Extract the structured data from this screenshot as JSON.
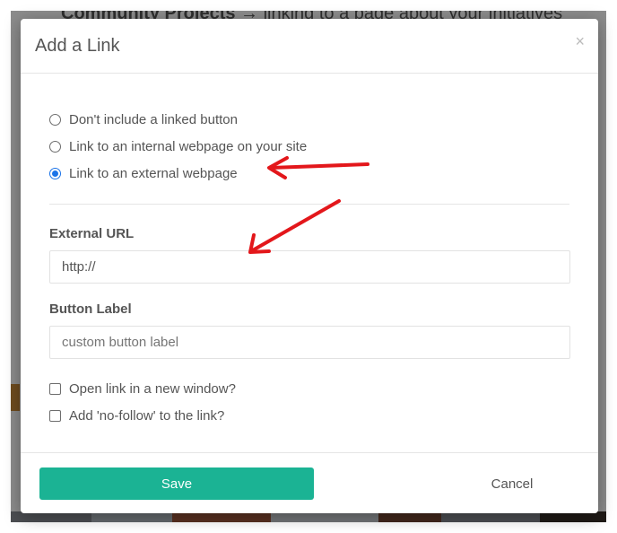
{
  "background": {
    "heading_bold": "Community Projects",
    "heading_rest": " → linking to a page about your initiatives"
  },
  "modal": {
    "title": "Add a Link",
    "close_glyph": "×",
    "options": [
      {
        "label": "Don't include a linked button",
        "checked": false
      },
      {
        "label": "Link to an internal webpage on your site",
        "checked": false
      },
      {
        "label": "Link to an external webpage",
        "checked": true
      }
    ],
    "external_url": {
      "label": "External URL",
      "value": "http://"
    },
    "button_label": {
      "label": "Button Label",
      "placeholder": "custom button label"
    },
    "new_window": {
      "label": "Open link in a new window?",
      "checked": false
    },
    "no_follow": {
      "label": "Add 'no-follow' to the link?",
      "checked": false
    },
    "save_label": "Save",
    "cancel_label": "Cancel"
  },
  "colors": {
    "save_button": "#1bb394",
    "radio_selected": "#1a73e8",
    "annotation_arrow": "#e3171b"
  }
}
